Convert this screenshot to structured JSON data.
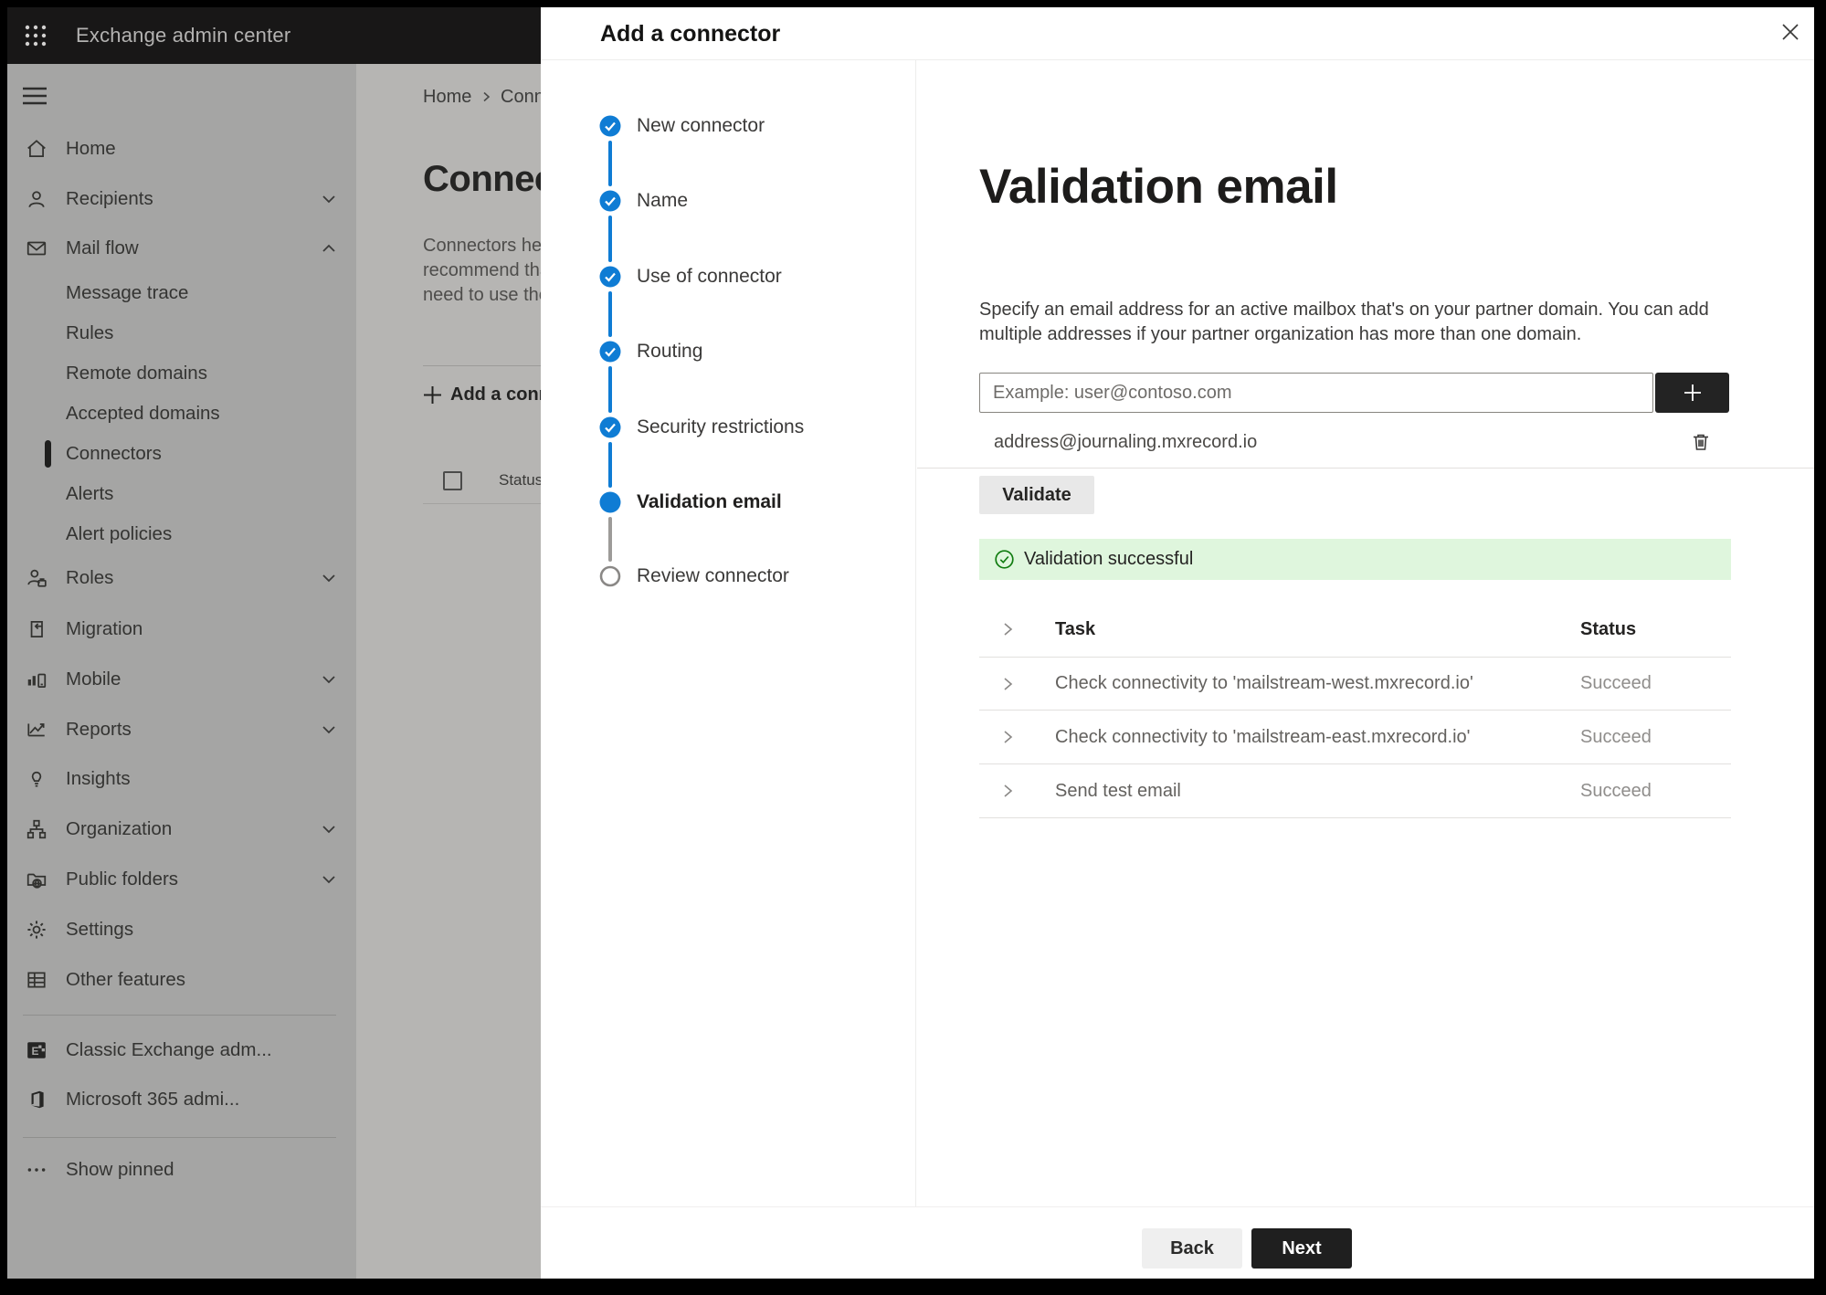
{
  "topbar": {
    "title": "Exchange admin center"
  },
  "sidebar": {
    "items": [
      {
        "label": "Home"
      },
      {
        "label": "Recipients"
      },
      {
        "label": "Mail flow"
      },
      {
        "label": "Message trace"
      },
      {
        "label": "Rules"
      },
      {
        "label": "Remote domains"
      },
      {
        "label": "Accepted domains"
      },
      {
        "label": "Connectors",
        "selected": true
      },
      {
        "label": "Alerts"
      },
      {
        "label": "Alert policies"
      },
      {
        "label": "Roles"
      },
      {
        "label": "Migration"
      },
      {
        "label": "Mobile"
      },
      {
        "label": "Reports"
      },
      {
        "label": "Insights"
      },
      {
        "label": "Organization"
      },
      {
        "label": "Public folders"
      },
      {
        "label": "Settings"
      },
      {
        "label": "Other features"
      },
      {
        "label": "Classic Exchange adm..."
      },
      {
        "label": "Microsoft 365 admi..."
      },
      {
        "label": "Show pinned"
      }
    ]
  },
  "page": {
    "breadcrumb": {
      "home": "Home",
      "current": "Conne"
    },
    "title": "Connec",
    "description_lines": [
      "Connectors help",
      "recommend tha",
      "need to use ther"
    ],
    "add_button": "Add a conn",
    "status_column": "Status"
  },
  "dialog": {
    "title": "Add a connector",
    "steps": [
      {
        "label": "New connector",
        "state": "completed"
      },
      {
        "label": "Name",
        "state": "completed"
      },
      {
        "label": "Use of connector",
        "state": "completed"
      },
      {
        "label": "Routing",
        "state": "completed"
      },
      {
        "label": "Security restrictions",
        "state": "completed"
      },
      {
        "label": "Validation email",
        "state": "current"
      },
      {
        "label": "Review connector",
        "state": "upcoming"
      }
    ],
    "heading": "Validation email",
    "description_lines": [
      "Specify an email address for an active mailbox that's on your partner domain. You can add",
      "multiple addresses if your partner organization has more than one domain."
    ],
    "email_input": {
      "placeholder": "Example: user@contoso.com"
    },
    "added_address": "address@journaling.mxrecord.io",
    "validate_button": "Validate",
    "banner": {
      "text": "Validation successful"
    },
    "table": {
      "headers": {
        "task": "Task",
        "status": "Status"
      },
      "rows": [
        {
          "task": "Check connectivity to 'mailstream-west.mxrecord.io'",
          "status": "Succeed"
        },
        {
          "task": "Check connectivity to 'mailstream-east.mxrecord.io'",
          "status": "Succeed"
        },
        {
          "task": "Send test email",
          "status": "Succeed"
        }
      ]
    },
    "footer": {
      "back": "Back",
      "next": "Next"
    }
  },
  "colors": {
    "accent": "#0f7cd4",
    "success_bg": "#dff6dd",
    "success_icon": "#107c10"
  }
}
